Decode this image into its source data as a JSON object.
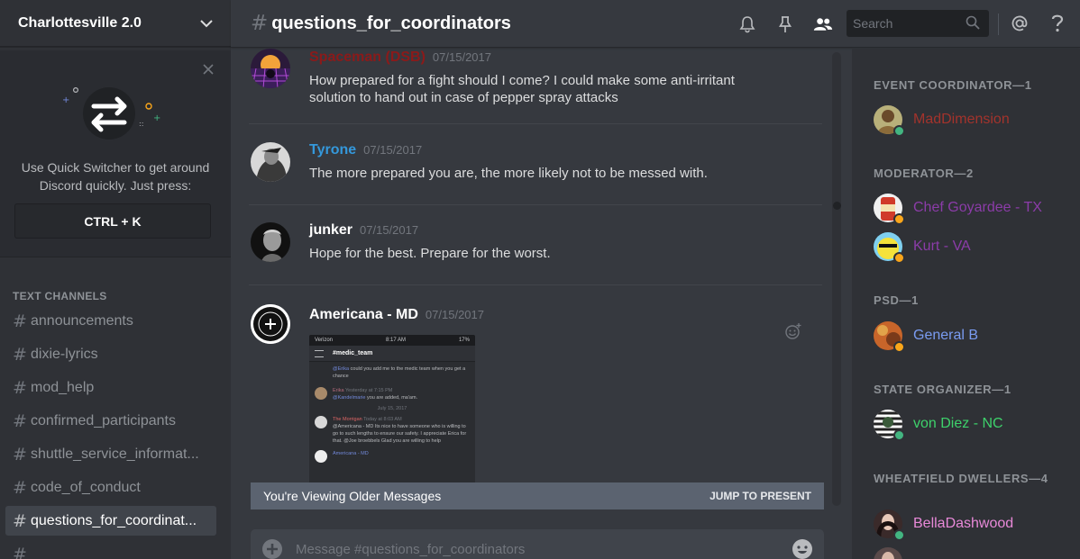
{
  "server": {
    "name": "Charlottesville 2.0"
  },
  "quick_switcher": {
    "text": "Use Quick Switcher to get around Discord quickly. Just press:",
    "shortcut": "CTRL + K"
  },
  "channels": {
    "category": "TEXT CHANNELS",
    "items": [
      {
        "name": "announcements"
      },
      {
        "name": "dixie-lyrics"
      },
      {
        "name": "mod_help"
      },
      {
        "name": "confirmed_participants"
      },
      {
        "name": "shuttle_service_informat..."
      },
      {
        "name": "code_of_conduct"
      },
      {
        "name": "questions_for_coordinat...",
        "active": true
      },
      {
        "name": ""
      }
    ]
  },
  "header": {
    "channel": "questions_for_coordinators",
    "search_placeholder": "Search",
    "icons": [
      "bell-icon",
      "pin-icon",
      "members-icon",
      "search-icon",
      "at-icon",
      "help-icon"
    ]
  },
  "messages": [
    {
      "author": "Spaceman (DSB)",
      "color": "#8b1a1a",
      "time": "07/15/2017",
      "text": "How prepared for a fight should I come? I could make some anti-irritant solution to hand out in case of pepper spray attacks"
    },
    {
      "author": "Tyrone",
      "color": "#3498db",
      "time": "07/15/2017",
      "text": "The more prepared you are, the more likely not to be messed with."
    },
    {
      "author": "junker",
      "color": "#ffffff",
      "time": "07/15/2017",
      "text": "Hope for the best. Prepare for the worst."
    },
    {
      "author": "Americana - MD",
      "color": "#ffffff",
      "time": "07/15/2017",
      "text": "",
      "attachment": {
        "carrier": "Verizon",
        "clock": "8:17 AM",
        "battery": "17%",
        "channel": "#medic_team",
        "lines": [
          {
            "author": "",
            "mention": "@Erika",
            "text": "could you add me to the medic team when you get a chance"
          },
          {
            "author": "Erika",
            "time": "Yesterday at 7:15 PM",
            "mention": "@Kandelmarie",
            "text": "you are added, ma'am."
          },
          {
            "divider": "July 15, 2017"
          },
          {
            "author": "The Morrigan",
            "time": "Today at 8:03 AM",
            "mention": "",
            "text": "@Americana - MD Its nice to have someone who is willing to go to such lengths to ensure our safety. I appreciate Erica for that. @Joe broebbels Glad you are willing to help"
          },
          {
            "author": "Americana - MD",
            "time": "",
            "mention": "",
            "text": ""
          }
        ]
      }
    }
  ],
  "older_bar": {
    "text": "You're Viewing Older Messages",
    "jump": "JUMP TO PRESENT"
  },
  "composer": {
    "placeholder": "Message #questions_for_coordinators"
  },
  "member_groups": [
    {
      "title": "EVENT COORDINATOR—1",
      "members": [
        {
          "name": "MadDimension",
          "color": "#a3332c",
          "status": "online"
        }
      ]
    },
    {
      "title": "MODERATOR—2",
      "members": [
        {
          "name": "Chef Goyardee - TX",
          "color": "#8b3ca8",
          "status": "idle"
        },
        {
          "name": "Kurt - VA",
          "color": "#8b3ca8",
          "status": "idle"
        }
      ]
    },
    {
      "title": "PSD—1",
      "members": [
        {
          "name": "General B",
          "color": "#7a9cf2",
          "status": "idle"
        }
      ]
    },
    {
      "title": "STATE ORGANIZER—1",
      "members": [
        {
          "name": "von Diez - NC",
          "color": "#3ed16b",
          "status": "online"
        }
      ]
    },
    {
      "title": "WHEATFIELD DWELLERS—4",
      "members": [
        {
          "name": "BellaDashwood",
          "color": "#e889d8",
          "status": "online"
        },
        {
          "name": "",
          "color": "#e889d8",
          "status": "online"
        }
      ]
    }
  ],
  "status_colors": {
    "online": "#43b581",
    "idle": "#faa61a"
  }
}
